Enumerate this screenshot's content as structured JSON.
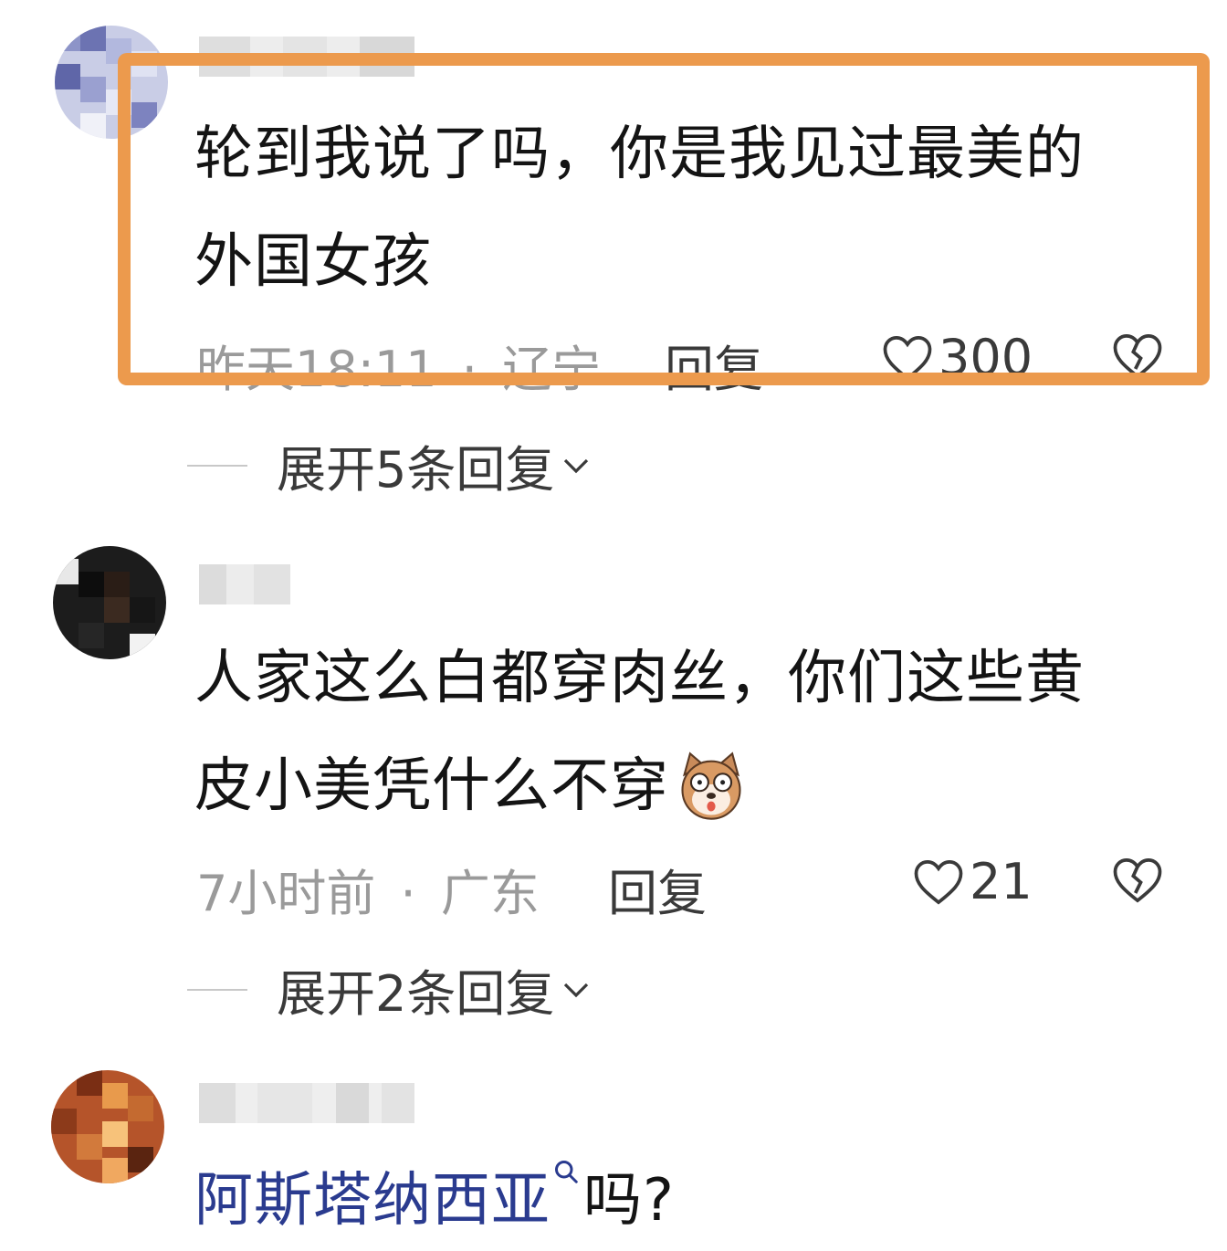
{
  "comments": [
    {
      "text_line1": "轮到我说了吗，你是我见过最美的",
      "text_line2": "外国女孩",
      "time": "昨天18:11",
      "separator": "·",
      "location": "辽宁",
      "reply_label": "回复",
      "likes": "300",
      "expand_label": "展开5条回复",
      "highlighted": true,
      "highlight_color": "#ec9a4d"
    },
    {
      "text_line1": "人家这么白都穿肉丝，你们这些黄",
      "text_line2": "皮小美凭什么不穿",
      "emoji": "dog-emoji",
      "time": "7小时前",
      "separator": "·",
      "location": "广东",
      "reply_label": "回复",
      "likes": "21",
      "expand_label": "展开2条回复"
    },
    {
      "link_text": "阿斯塔纳西亚",
      "text_suffix": "吗?",
      "link_color": "#2a3b8f"
    }
  ],
  "icons": {
    "like": "heart-outline-icon",
    "dislike": "broken-heart-icon",
    "expand": "chevron-down-icon",
    "search": "search-icon"
  }
}
